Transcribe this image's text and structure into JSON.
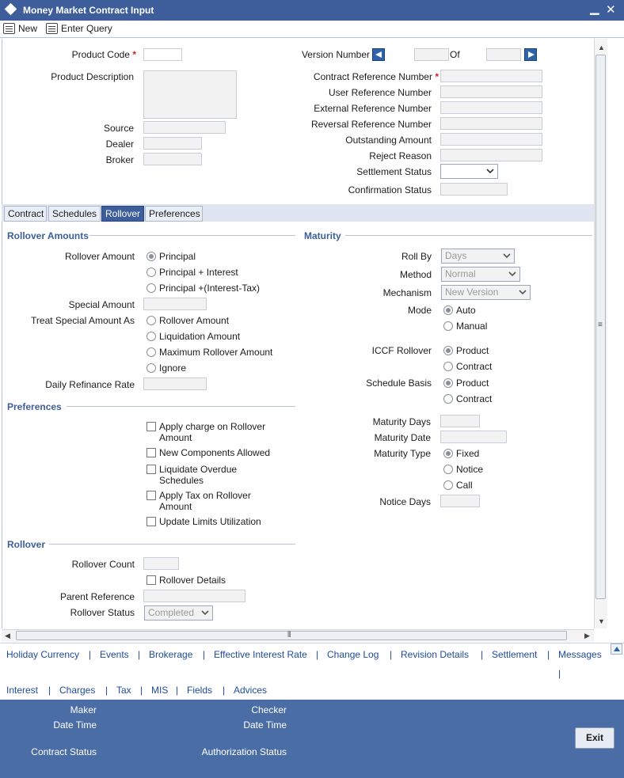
{
  "window": {
    "title": "Money Market Contract Input",
    "minimize": "▁",
    "close": "✕"
  },
  "toolbar": {
    "new_label": "New",
    "enter_query_label": "Enter Query"
  },
  "header": {
    "product_code_label": "Product Code",
    "product_description_label": "Product Description",
    "source_label": "Source",
    "dealer_label": "Dealer",
    "broker_label": "Broker",
    "version_number_label": "Version Number",
    "of_label": "Of",
    "contract_ref_label": "Contract Reference Number",
    "user_ref_label": "User Reference Number",
    "external_ref_label": "External Reference Number",
    "reversal_ref_label": "Reversal Reference Number",
    "outstanding_label": "Outstanding Amount",
    "reject_reason_label": "Reject Reason",
    "settlement_status_label": "Settlement Status",
    "confirmation_status_label": "Confirmation Status",
    "required_mark": "*"
  },
  "tabs": [
    {
      "label": "Contract"
    },
    {
      "label": "Schedules"
    },
    {
      "label": "Rollover",
      "active": true
    },
    {
      "label": "Preferences"
    }
  ],
  "rollover_amounts": {
    "title": "Rollover Amounts",
    "rollover_amount_label": "Rollover Amount",
    "options": [
      "Principal",
      "Principal + Interest",
      "Principal +(Interest-Tax)"
    ],
    "selected": "Principal",
    "special_amount_label": "Special Amount",
    "treat_special_label": "Treat Special Amount As",
    "treat_options": [
      "Rollover Amount",
      "Liquidation Amount",
      "Maximum Rollover Amount",
      "Ignore"
    ],
    "daily_refinance_label": "Daily Refinance Rate"
  },
  "preferences": {
    "title": "Preferences",
    "items": [
      "Apply charge on Rollover Amount",
      "New Components Allowed",
      "Liquidate Overdue Schedules",
      "Apply Tax on Rollover Amount",
      "Update Limits Utilization"
    ]
  },
  "rollover": {
    "title": "Rollover",
    "count_label": "Rollover Count",
    "details_label": "Rollover Details",
    "parent_ref_label": "Parent Reference",
    "status_label": "Rollover Status",
    "status_value": "Completed"
  },
  "maturity": {
    "title": "Maturity",
    "roll_by_label": "Roll By",
    "roll_by_value": "Days",
    "method_label": "Method",
    "method_value": "Normal",
    "mechanism_label": "Mechanism",
    "mechanism_value": "New Version",
    "mode_label": "Mode",
    "mode_options": [
      "Auto",
      "Manual"
    ],
    "mode_selected": "Auto",
    "iccf_label": "ICCF Rollover",
    "iccf_options": [
      "Product",
      "Contract"
    ],
    "iccf_selected": "Product",
    "schedule_basis_label": "Schedule Basis",
    "schedule_basis_options": [
      "Product",
      "Contract"
    ],
    "schedule_basis_selected": "Product",
    "maturity_days_label": "Maturity Days",
    "maturity_date_label": "Maturity Date",
    "maturity_type_label": "Maturity Type",
    "maturity_type_options": [
      "Fixed",
      "Notice",
      "Call"
    ],
    "maturity_type_selected": "Fixed",
    "notice_days_label": "Notice Days"
  },
  "links_row1": [
    "Holiday Currency",
    "Events",
    "Brokerage",
    "Effective Interest Rate",
    "Change Log",
    "Revision Details",
    "Settlement",
    "Messages"
  ],
  "links_row2": [
    "Interest",
    "Charges",
    "Tax",
    "MIS",
    "Fields",
    "Advices"
  ],
  "link_separator": "|",
  "footer": {
    "maker_label": "Maker",
    "maker_datetime_label": "Date Time",
    "checker_label": "Checker",
    "checker_datetime_label": "Date Time",
    "contract_status_label": "Contract Status",
    "authorization_status_label": "Authorization Status",
    "exit_label": "Exit"
  },
  "colors": {
    "titlebar": "#3d5e9b",
    "footer": "#4a6da5",
    "link": "#1f4a9c",
    "section": "#3d5e9b"
  }
}
